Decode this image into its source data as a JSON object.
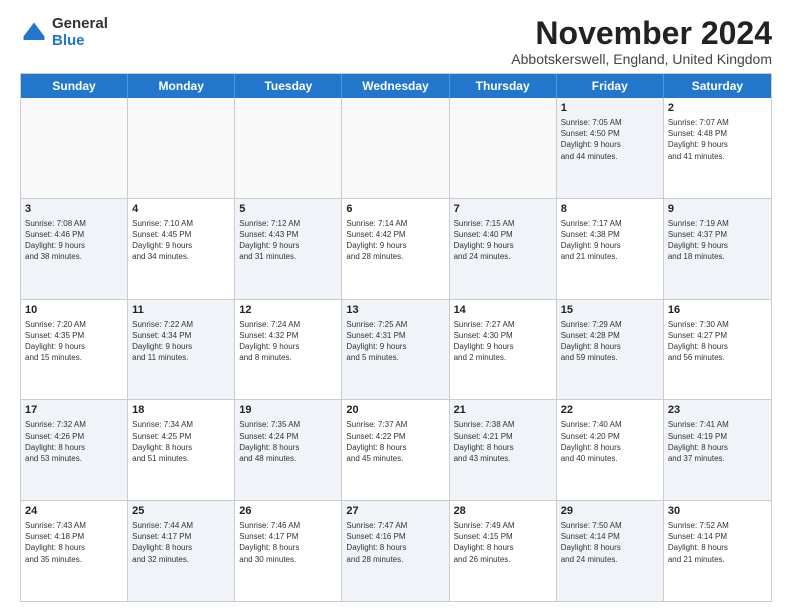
{
  "logo": {
    "general": "General",
    "blue": "Blue"
  },
  "title": "November 2024",
  "location": "Abbotskerswell, England, United Kingdom",
  "header_days": [
    "Sunday",
    "Monday",
    "Tuesday",
    "Wednesday",
    "Thursday",
    "Friday",
    "Saturday"
  ],
  "rows": [
    [
      {
        "day": "",
        "info": "",
        "empty": true
      },
      {
        "day": "",
        "info": "",
        "empty": true
      },
      {
        "day": "",
        "info": "",
        "empty": true
      },
      {
        "day": "",
        "info": "",
        "empty": true
      },
      {
        "day": "",
        "info": "",
        "empty": true
      },
      {
        "day": "1",
        "info": "Sunrise: 7:05 AM\nSunset: 4:50 PM\nDaylight: 9 hours\nand 44 minutes.",
        "shaded": true
      },
      {
        "day": "2",
        "info": "Sunrise: 7:07 AM\nSunset: 4:48 PM\nDaylight: 9 hours\nand 41 minutes.",
        "shaded": false
      }
    ],
    [
      {
        "day": "3",
        "info": "Sunrise: 7:08 AM\nSunset: 4:46 PM\nDaylight: 9 hours\nand 38 minutes.",
        "shaded": true
      },
      {
        "day": "4",
        "info": "Sunrise: 7:10 AM\nSunset: 4:45 PM\nDaylight: 9 hours\nand 34 minutes.",
        "shaded": false
      },
      {
        "day": "5",
        "info": "Sunrise: 7:12 AM\nSunset: 4:43 PM\nDaylight: 9 hours\nand 31 minutes.",
        "shaded": true
      },
      {
        "day": "6",
        "info": "Sunrise: 7:14 AM\nSunset: 4:42 PM\nDaylight: 9 hours\nand 28 minutes.",
        "shaded": false
      },
      {
        "day": "7",
        "info": "Sunrise: 7:15 AM\nSunset: 4:40 PM\nDaylight: 9 hours\nand 24 minutes.",
        "shaded": true
      },
      {
        "day": "8",
        "info": "Sunrise: 7:17 AM\nSunset: 4:38 PM\nDaylight: 9 hours\nand 21 minutes.",
        "shaded": false
      },
      {
        "day": "9",
        "info": "Sunrise: 7:19 AM\nSunset: 4:37 PM\nDaylight: 9 hours\nand 18 minutes.",
        "shaded": true
      }
    ],
    [
      {
        "day": "10",
        "info": "Sunrise: 7:20 AM\nSunset: 4:35 PM\nDaylight: 9 hours\nand 15 minutes.",
        "shaded": false
      },
      {
        "day": "11",
        "info": "Sunrise: 7:22 AM\nSunset: 4:34 PM\nDaylight: 9 hours\nand 11 minutes.",
        "shaded": true
      },
      {
        "day": "12",
        "info": "Sunrise: 7:24 AM\nSunset: 4:32 PM\nDaylight: 9 hours\nand 8 minutes.",
        "shaded": false
      },
      {
        "day": "13",
        "info": "Sunrise: 7:25 AM\nSunset: 4:31 PM\nDaylight: 9 hours\nand 5 minutes.",
        "shaded": true
      },
      {
        "day": "14",
        "info": "Sunrise: 7:27 AM\nSunset: 4:30 PM\nDaylight: 9 hours\nand 2 minutes.",
        "shaded": false
      },
      {
        "day": "15",
        "info": "Sunrise: 7:29 AM\nSunset: 4:28 PM\nDaylight: 8 hours\nand 59 minutes.",
        "shaded": true
      },
      {
        "day": "16",
        "info": "Sunrise: 7:30 AM\nSunset: 4:27 PM\nDaylight: 8 hours\nand 56 minutes.",
        "shaded": false
      }
    ],
    [
      {
        "day": "17",
        "info": "Sunrise: 7:32 AM\nSunset: 4:26 PM\nDaylight: 8 hours\nand 53 minutes.",
        "shaded": true
      },
      {
        "day": "18",
        "info": "Sunrise: 7:34 AM\nSunset: 4:25 PM\nDaylight: 8 hours\nand 51 minutes.",
        "shaded": false
      },
      {
        "day": "19",
        "info": "Sunrise: 7:35 AM\nSunset: 4:24 PM\nDaylight: 8 hours\nand 48 minutes.",
        "shaded": true
      },
      {
        "day": "20",
        "info": "Sunrise: 7:37 AM\nSunset: 4:22 PM\nDaylight: 8 hours\nand 45 minutes.",
        "shaded": false
      },
      {
        "day": "21",
        "info": "Sunrise: 7:38 AM\nSunset: 4:21 PM\nDaylight: 8 hours\nand 43 minutes.",
        "shaded": true
      },
      {
        "day": "22",
        "info": "Sunrise: 7:40 AM\nSunset: 4:20 PM\nDaylight: 8 hours\nand 40 minutes.",
        "shaded": false
      },
      {
        "day": "23",
        "info": "Sunrise: 7:41 AM\nSunset: 4:19 PM\nDaylight: 8 hours\nand 37 minutes.",
        "shaded": true
      }
    ],
    [
      {
        "day": "24",
        "info": "Sunrise: 7:43 AM\nSunset: 4:18 PM\nDaylight: 8 hours\nand 35 minutes.",
        "shaded": false
      },
      {
        "day": "25",
        "info": "Sunrise: 7:44 AM\nSunset: 4:17 PM\nDaylight: 8 hours\nand 32 minutes.",
        "shaded": true
      },
      {
        "day": "26",
        "info": "Sunrise: 7:46 AM\nSunset: 4:17 PM\nDaylight: 8 hours\nand 30 minutes.",
        "shaded": false
      },
      {
        "day": "27",
        "info": "Sunrise: 7:47 AM\nSunset: 4:16 PM\nDaylight: 8 hours\nand 28 minutes.",
        "shaded": true
      },
      {
        "day": "28",
        "info": "Sunrise: 7:49 AM\nSunset: 4:15 PM\nDaylight: 8 hours\nand 26 minutes.",
        "shaded": false
      },
      {
        "day": "29",
        "info": "Sunrise: 7:50 AM\nSunset: 4:14 PM\nDaylight: 8 hours\nand 24 minutes.",
        "shaded": true
      },
      {
        "day": "30",
        "info": "Sunrise: 7:52 AM\nSunset: 4:14 PM\nDaylight: 8 hours\nand 21 minutes.",
        "shaded": false
      }
    ]
  ]
}
